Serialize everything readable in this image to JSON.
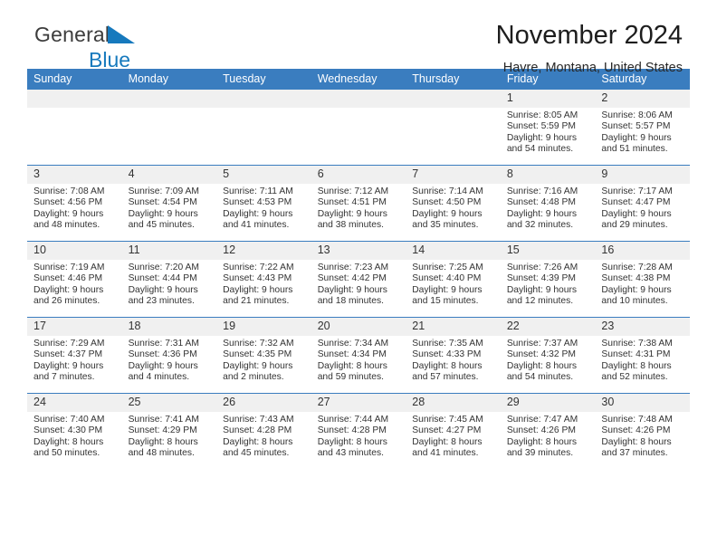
{
  "logo": {
    "word_one": "General",
    "word_two": "Blue",
    "triangle_icon": "blue-triangle-icon",
    "brand_blue": "#1679bd",
    "brand_gray": "#3c3c3c"
  },
  "header": {
    "title": "November 2024",
    "location": "Havre, Montana, United States"
  },
  "calendar": {
    "header_background": "#3a7dbf",
    "daynum_background": "#f0f0f0",
    "weekdays": [
      "Sunday",
      "Monday",
      "Tuesday",
      "Wednesday",
      "Thursday",
      "Friday",
      "Saturday"
    ],
    "weeks": [
      [
        {
          "day": "",
          "empty": true
        },
        {
          "day": "",
          "empty": true
        },
        {
          "day": "",
          "empty": true
        },
        {
          "day": "",
          "empty": true
        },
        {
          "day": "",
          "empty": true
        },
        {
          "day": "1",
          "sunrise": "Sunrise: 8:05 AM",
          "sunset": "Sunset: 5:59 PM",
          "daylight_line1": "Daylight: 9 hours",
          "daylight_line2": "and 54 minutes."
        },
        {
          "day": "2",
          "sunrise": "Sunrise: 8:06 AM",
          "sunset": "Sunset: 5:57 PM",
          "daylight_line1": "Daylight: 9 hours",
          "daylight_line2": "and 51 minutes."
        }
      ],
      [
        {
          "day": "3",
          "sunrise": "Sunrise: 7:08 AM",
          "sunset": "Sunset: 4:56 PM",
          "daylight_line1": "Daylight: 9 hours",
          "daylight_line2": "and 48 minutes."
        },
        {
          "day": "4",
          "sunrise": "Sunrise: 7:09 AM",
          "sunset": "Sunset: 4:54 PM",
          "daylight_line1": "Daylight: 9 hours",
          "daylight_line2": "and 45 minutes."
        },
        {
          "day": "5",
          "sunrise": "Sunrise: 7:11 AM",
          "sunset": "Sunset: 4:53 PM",
          "daylight_line1": "Daylight: 9 hours",
          "daylight_line2": "and 41 minutes."
        },
        {
          "day": "6",
          "sunrise": "Sunrise: 7:12 AM",
          "sunset": "Sunset: 4:51 PM",
          "daylight_line1": "Daylight: 9 hours",
          "daylight_line2": "and 38 minutes."
        },
        {
          "day": "7",
          "sunrise": "Sunrise: 7:14 AM",
          "sunset": "Sunset: 4:50 PM",
          "daylight_line1": "Daylight: 9 hours",
          "daylight_line2": "and 35 minutes."
        },
        {
          "day": "8",
          "sunrise": "Sunrise: 7:16 AM",
          "sunset": "Sunset: 4:48 PM",
          "daylight_line1": "Daylight: 9 hours",
          "daylight_line2": "and 32 minutes."
        },
        {
          "day": "9",
          "sunrise": "Sunrise: 7:17 AM",
          "sunset": "Sunset: 4:47 PM",
          "daylight_line1": "Daylight: 9 hours",
          "daylight_line2": "and 29 minutes."
        }
      ],
      [
        {
          "day": "10",
          "sunrise": "Sunrise: 7:19 AM",
          "sunset": "Sunset: 4:46 PM",
          "daylight_line1": "Daylight: 9 hours",
          "daylight_line2": "and 26 minutes."
        },
        {
          "day": "11",
          "sunrise": "Sunrise: 7:20 AM",
          "sunset": "Sunset: 4:44 PM",
          "daylight_line1": "Daylight: 9 hours",
          "daylight_line2": "and 23 minutes."
        },
        {
          "day": "12",
          "sunrise": "Sunrise: 7:22 AM",
          "sunset": "Sunset: 4:43 PM",
          "daylight_line1": "Daylight: 9 hours",
          "daylight_line2": "and 21 minutes."
        },
        {
          "day": "13",
          "sunrise": "Sunrise: 7:23 AM",
          "sunset": "Sunset: 4:42 PM",
          "daylight_line1": "Daylight: 9 hours",
          "daylight_line2": "and 18 minutes."
        },
        {
          "day": "14",
          "sunrise": "Sunrise: 7:25 AM",
          "sunset": "Sunset: 4:40 PM",
          "daylight_line1": "Daylight: 9 hours",
          "daylight_line2": "and 15 minutes."
        },
        {
          "day": "15",
          "sunrise": "Sunrise: 7:26 AM",
          "sunset": "Sunset: 4:39 PM",
          "daylight_line1": "Daylight: 9 hours",
          "daylight_line2": "and 12 minutes."
        },
        {
          "day": "16",
          "sunrise": "Sunrise: 7:28 AM",
          "sunset": "Sunset: 4:38 PM",
          "daylight_line1": "Daylight: 9 hours",
          "daylight_line2": "and 10 minutes."
        }
      ],
      [
        {
          "day": "17",
          "sunrise": "Sunrise: 7:29 AM",
          "sunset": "Sunset: 4:37 PM",
          "daylight_line1": "Daylight: 9 hours",
          "daylight_line2": "and 7 minutes."
        },
        {
          "day": "18",
          "sunrise": "Sunrise: 7:31 AM",
          "sunset": "Sunset: 4:36 PM",
          "daylight_line1": "Daylight: 9 hours",
          "daylight_line2": "and 4 minutes."
        },
        {
          "day": "19",
          "sunrise": "Sunrise: 7:32 AM",
          "sunset": "Sunset: 4:35 PM",
          "daylight_line1": "Daylight: 9 hours",
          "daylight_line2": "and 2 minutes."
        },
        {
          "day": "20",
          "sunrise": "Sunrise: 7:34 AM",
          "sunset": "Sunset: 4:34 PM",
          "daylight_line1": "Daylight: 8 hours",
          "daylight_line2": "and 59 minutes."
        },
        {
          "day": "21",
          "sunrise": "Sunrise: 7:35 AM",
          "sunset": "Sunset: 4:33 PM",
          "daylight_line1": "Daylight: 8 hours",
          "daylight_line2": "and 57 minutes."
        },
        {
          "day": "22",
          "sunrise": "Sunrise: 7:37 AM",
          "sunset": "Sunset: 4:32 PM",
          "daylight_line1": "Daylight: 8 hours",
          "daylight_line2": "and 54 minutes."
        },
        {
          "day": "23",
          "sunrise": "Sunrise: 7:38 AM",
          "sunset": "Sunset: 4:31 PM",
          "daylight_line1": "Daylight: 8 hours",
          "daylight_line2": "and 52 minutes."
        }
      ],
      [
        {
          "day": "24",
          "sunrise": "Sunrise: 7:40 AM",
          "sunset": "Sunset: 4:30 PM",
          "daylight_line1": "Daylight: 8 hours",
          "daylight_line2": "and 50 minutes."
        },
        {
          "day": "25",
          "sunrise": "Sunrise: 7:41 AM",
          "sunset": "Sunset: 4:29 PM",
          "daylight_line1": "Daylight: 8 hours",
          "daylight_line2": "and 48 minutes."
        },
        {
          "day": "26",
          "sunrise": "Sunrise: 7:43 AM",
          "sunset": "Sunset: 4:28 PM",
          "daylight_line1": "Daylight: 8 hours",
          "daylight_line2": "and 45 minutes."
        },
        {
          "day": "27",
          "sunrise": "Sunrise: 7:44 AM",
          "sunset": "Sunset: 4:28 PM",
          "daylight_line1": "Daylight: 8 hours",
          "daylight_line2": "and 43 minutes."
        },
        {
          "day": "28",
          "sunrise": "Sunrise: 7:45 AM",
          "sunset": "Sunset: 4:27 PM",
          "daylight_line1": "Daylight: 8 hours",
          "daylight_line2": "and 41 minutes."
        },
        {
          "day": "29",
          "sunrise": "Sunrise: 7:47 AM",
          "sunset": "Sunset: 4:26 PM",
          "daylight_line1": "Daylight: 8 hours",
          "daylight_line2": "and 39 minutes."
        },
        {
          "day": "30",
          "sunrise": "Sunrise: 7:48 AM",
          "sunset": "Sunset: 4:26 PM",
          "daylight_line1": "Daylight: 8 hours",
          "daylight_line2": "and 37 minutes."
        }
      ]
    ]
  }
}
